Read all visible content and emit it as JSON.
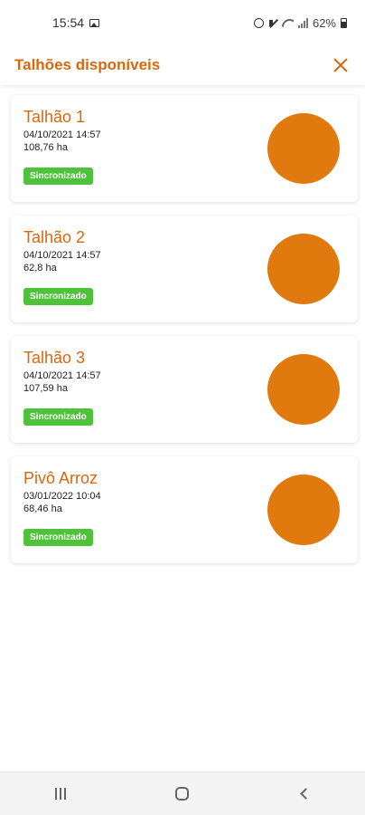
{
  "status_bar": {
    "time": "15:54",
    "battery": "62%"
  },
  "header": {
    "title": "Talhões disponíveis",
    "close_icon": "close-icon"
  },
  "plots": [
    {
      "name": "Talhão 1",
      "date": "04/10/2021 14:57",
      "area": "108,76 ha",
      "status": "Sincronizado"
    },
    {
      "name": "Talhão 2",
      "date": "04/10/2021 14:57",
      "area": "62,8 ha",
      "status": "Sincronizado"
    },
    {
      "name": "Talhão 3",
      "date": "04/10/2021 14:57",
      "area": "107,59 ha",
      "status": "Sincronizado"
    },
    {
      "name": "Pivô Arroz",
      "date": "03/01/2022 10:04",
      "area": "68,46 ha",
      "status": "Sincronizado"
    }
  ],
  "colors": {
    "accent": "#d9670f",
    "plot_shape": "#e07a0e",
    "synced_badge": "#4ec23a"
  },
  "nav_bar": {
    "icons": [
      "recents-icon",
      "home-icon",
      "back-icon"
    ]
  }
}
